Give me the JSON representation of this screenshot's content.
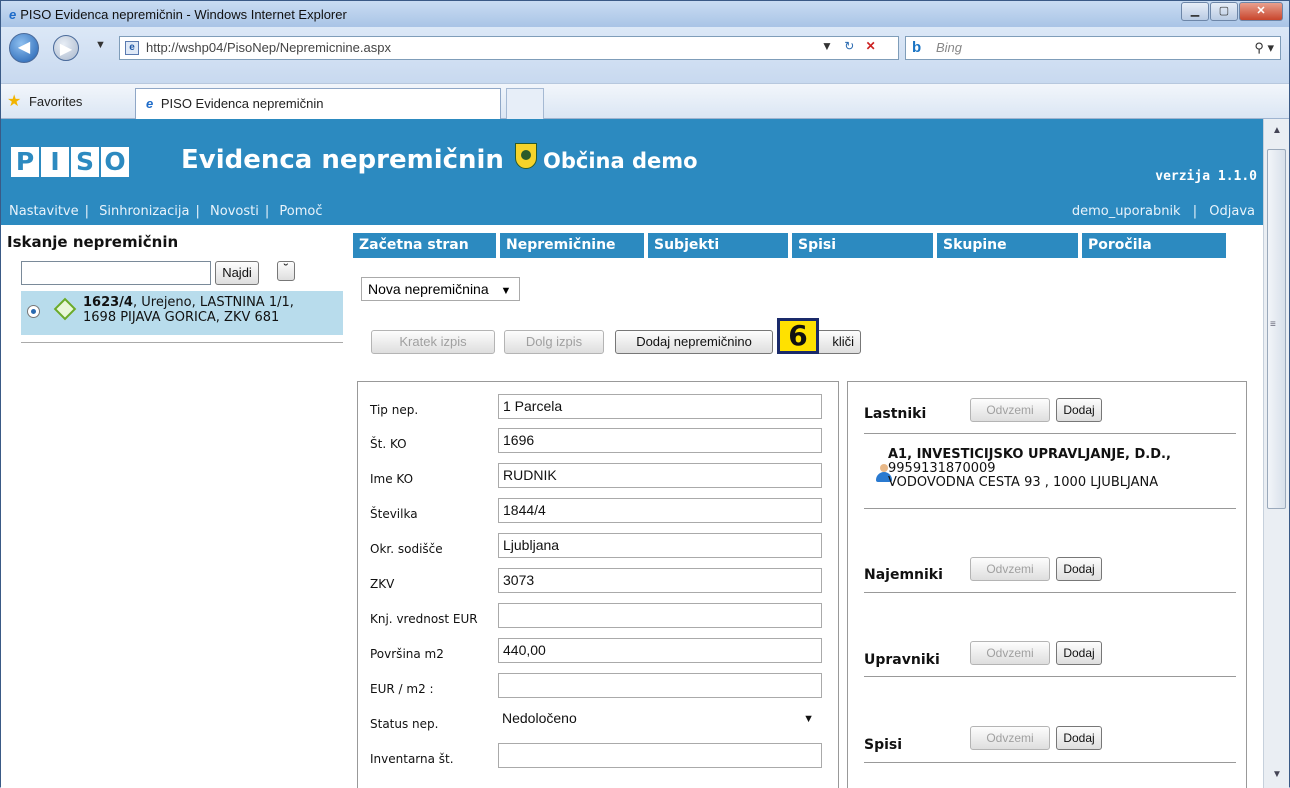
{
  "window": {
    "title": "PISO Evidenca nepremičnin - Windows Internet Explorer",
    "url": "http://wshp04/PisoNep/Nepremicnine.aspx",
    "search_placeholder": "Bing",
    "favorites_label": "Favorites",
    "tab_title": "PISO Evidenca nepremičnin"
  },
  "header": {
    "logo_letters": [
      "P",
      "I",
      "S",
      "O"
    ],
    "app_title": "Evidenca nepremičnin",
    "municipality": "Občina demo",
    "version": "verzija 1.1.0",
    "nav": [
      "Nastavitve",
      "Sinhronizacija",
      "Novosti",
      "Pomoč"
    ],
    "username": "demo_uporabnik",
    "logout": "Odjava"
  },
  "search": {
    "heading": "Iskanje nepremičnin",
    "button": "Najdi",
    "result_line1_bold": "1623/4",
    "result_line1_rest": ", Urejeno, LASTNINA 1/1,",
    "result_line2": "1698 PIJAVA GORICA, ZKV 681"
  },
  "menu": [
    "Začetna stran",
    "Nepremičnine",
    "Subjekti",
    "Spisi",
    "Skupine",
    "Poročila"
  ],
  "select_new": "Nova nepremičnina",
  "actions": {
    "short_print": "Kratek izpis",
    "long_print": "Dolg izpis",
    "add": "Dodaj nepremičnino",
    "cancel_partial": "kliči"
  },
  "badge": "6",
  "form": {
    "fields": [
      {
        "label": "Tip nep.",
        "value": "1  Parcela"
      },
      {
        "label": "Št. KO",
        "value": "1696"
      },
      {
        "label": "Ime KO",
        "value": "RUDNIK"
      },
      {
        "label": "Številka",
        "value": "1844/4"
      },
      {
        "label": "Okr. sodišče",
        "value": "Ljubljana"
      },
      {
        "label": "ZKV",
        "value": "3073"
      },
      {
        "label": "Knj. vrednost EUR",
        "value": ""
      },
      {
        "label": "Površina m2",
        "value": "440,00"
      },
      {
        "label": "EUR / m2 :",
        "value": ""
      },
      {
        "label": "Status nep.",
        "value": "Nedoločeno"
      },
      {
        "label": "Inventarna št.",
        "value": ""
      }
    ]
  },
  "side": {
    "remove": "Odvzemi",
    "add": "Dodaj",
    "owners_label": "Lastniki",
    "owner_name": "A1, INVESTICIJSKO UPRAVLJANJE, D.D.,",
    "owner_id": "9959131870009",
    "owner_address": "VODOVODNA CESTA 93 , 1000 LJUBLJANA",
    "tenants_label": "Najemniki",
    "managers_label": "Upravniki",
    "files_label": "Spisi"
  }
}
